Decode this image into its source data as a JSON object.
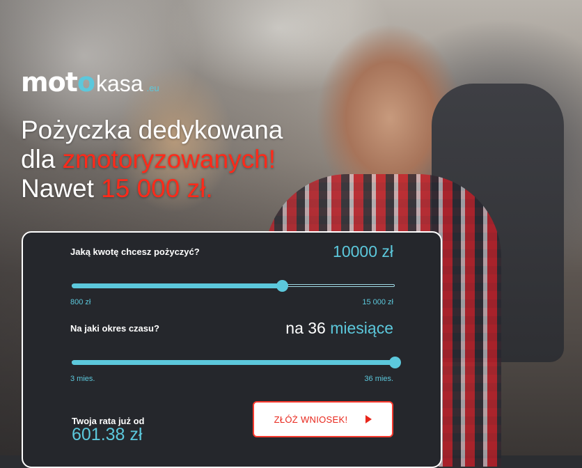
{
  "brand": {
    "moto_prefix": "mot",
    "moto_suffix": "o",
    "kasa": "kasa",
    "domain": ".eu",
    "accent_color": "#5cc8dc",
    "cta_color": "#e8261b"
  },
  "headline": {
    "line1": "Pożyczka dedykowana",
    "line2_prefix": "dla ",
    "line2_highlight": "zmotoryzowanych!",
    "line3_prefix": "Nawet ",
    "line3_highlight": "15 000 zł."
  },
  "calculator": {
    "amount": {
      "label": "Jaką kwotę chcesz pożyczyć?",
      "value": "10000 zł",
      "min_label": "800 zł",
      "max_label": "15 000 zł",
      "fraction": 0.65
    },
    "period": {
      "label": "Na jaki okres czasu?",
      "value_prefix": "na 36",
      "value_unit": "miesiące",
      "min_label": "3 mies.",
      "max_label": "36 mies.",
      "fraction": 1.0
    },
    "rate": {
      "label": "Twoja rata już od",
      "value": "601.38 zł"
    },
    "cta": {
      "label": "ZŁÓŻ WNIOSEK!",
      "icon": "play-arrow-icon"
    }
  }
}
